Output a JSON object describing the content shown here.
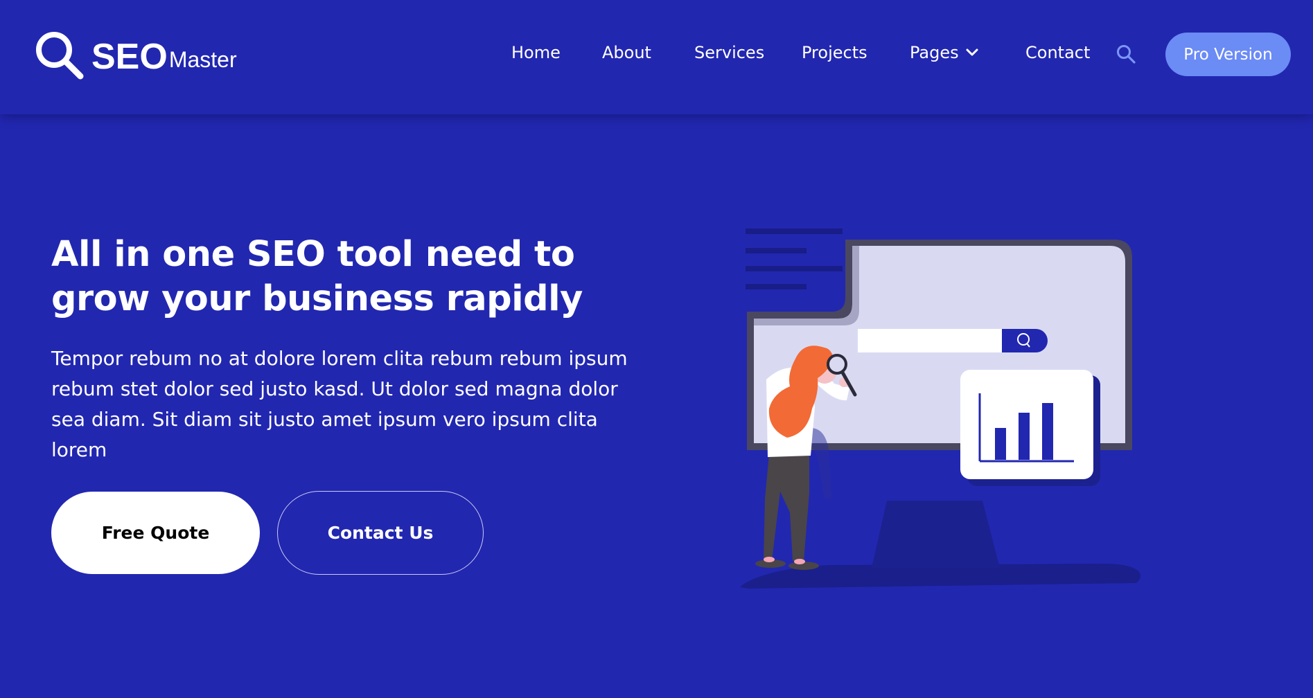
{
  "brand": {
    "name_bold": "SEO",
    "name_light": "Master",
    "icon": "magnifier-logo-icon"
  },
  "nav": {
    "items": [
      {
        "label": "Home"
      },
      {
        "label": "About"
      },
      {
        "label": "Services"
      },
      {
        "label": "Projects"
      },
      {
        "label": "Pages",
        "icon": "chevron-down-icon"
      },
      {
        "label": "Contact"
      }
    ],
    "search_icon": "search-icon",
    "pro_button": "Pro Version"
  },
  "hero": {
    "title": "All in one SEO tool need to grow your business rapidly",
    "text": "Tempor rebum no at dolore lorem clita rebum rebum ipsum rebum stet dolor sed justo kasd. Ut dolor sed magna dolor sea diam. Sit diam sit justo amet ipsum vero ipsum clita lorem",
    "primary_button": "Free Quote",
    "secondary_button": "Contact Us"
  },
  "colors": {
    "background": "#2227b0",
    "pro_button": "#6b8bf5",
    "search_icon": "#7b96f7",
    "illustration_hair": "#f26a35",
    "screen": "#d9daf2"
  }
}
